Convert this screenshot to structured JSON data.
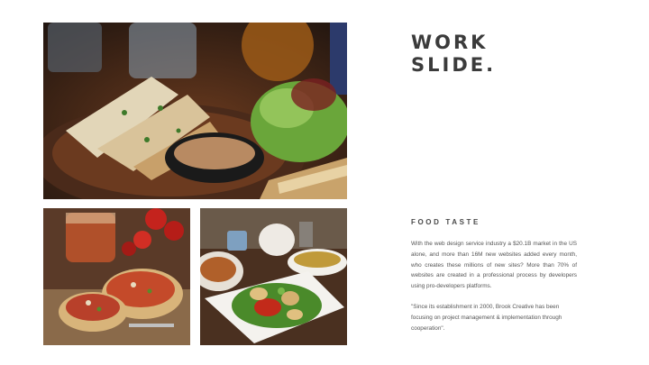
{
  "slide": {
    "title_line1": "WORK",
    "title_line2": "SLIDE.",
    "section_heading": "FOOD TASTE",
    "paragraph1": "With the web design service industry a $20.1B market in the US alone, and more than 16M new websites added every month, who creates these millions of new sites? More than 70% of websites are created in a professional process by developers using pro-developers platforms.",
    "paragraph2": "\"Since its establishment in 2000, Brook Creative has been focusing on project management & implementation through cooperation\"."
  },
  "photos": [
    {
      "name": "grilled-fish-salad-photo"
    },
    {
      "name": "bruschetta-photo"
    },
    {
      "name": "salad-bowl-photo"
    }
  ],
  "colors": {
    "title": "#3b3b3b",
    "body_text": "#555555",
    "background": "#ffffff"
  }
}
